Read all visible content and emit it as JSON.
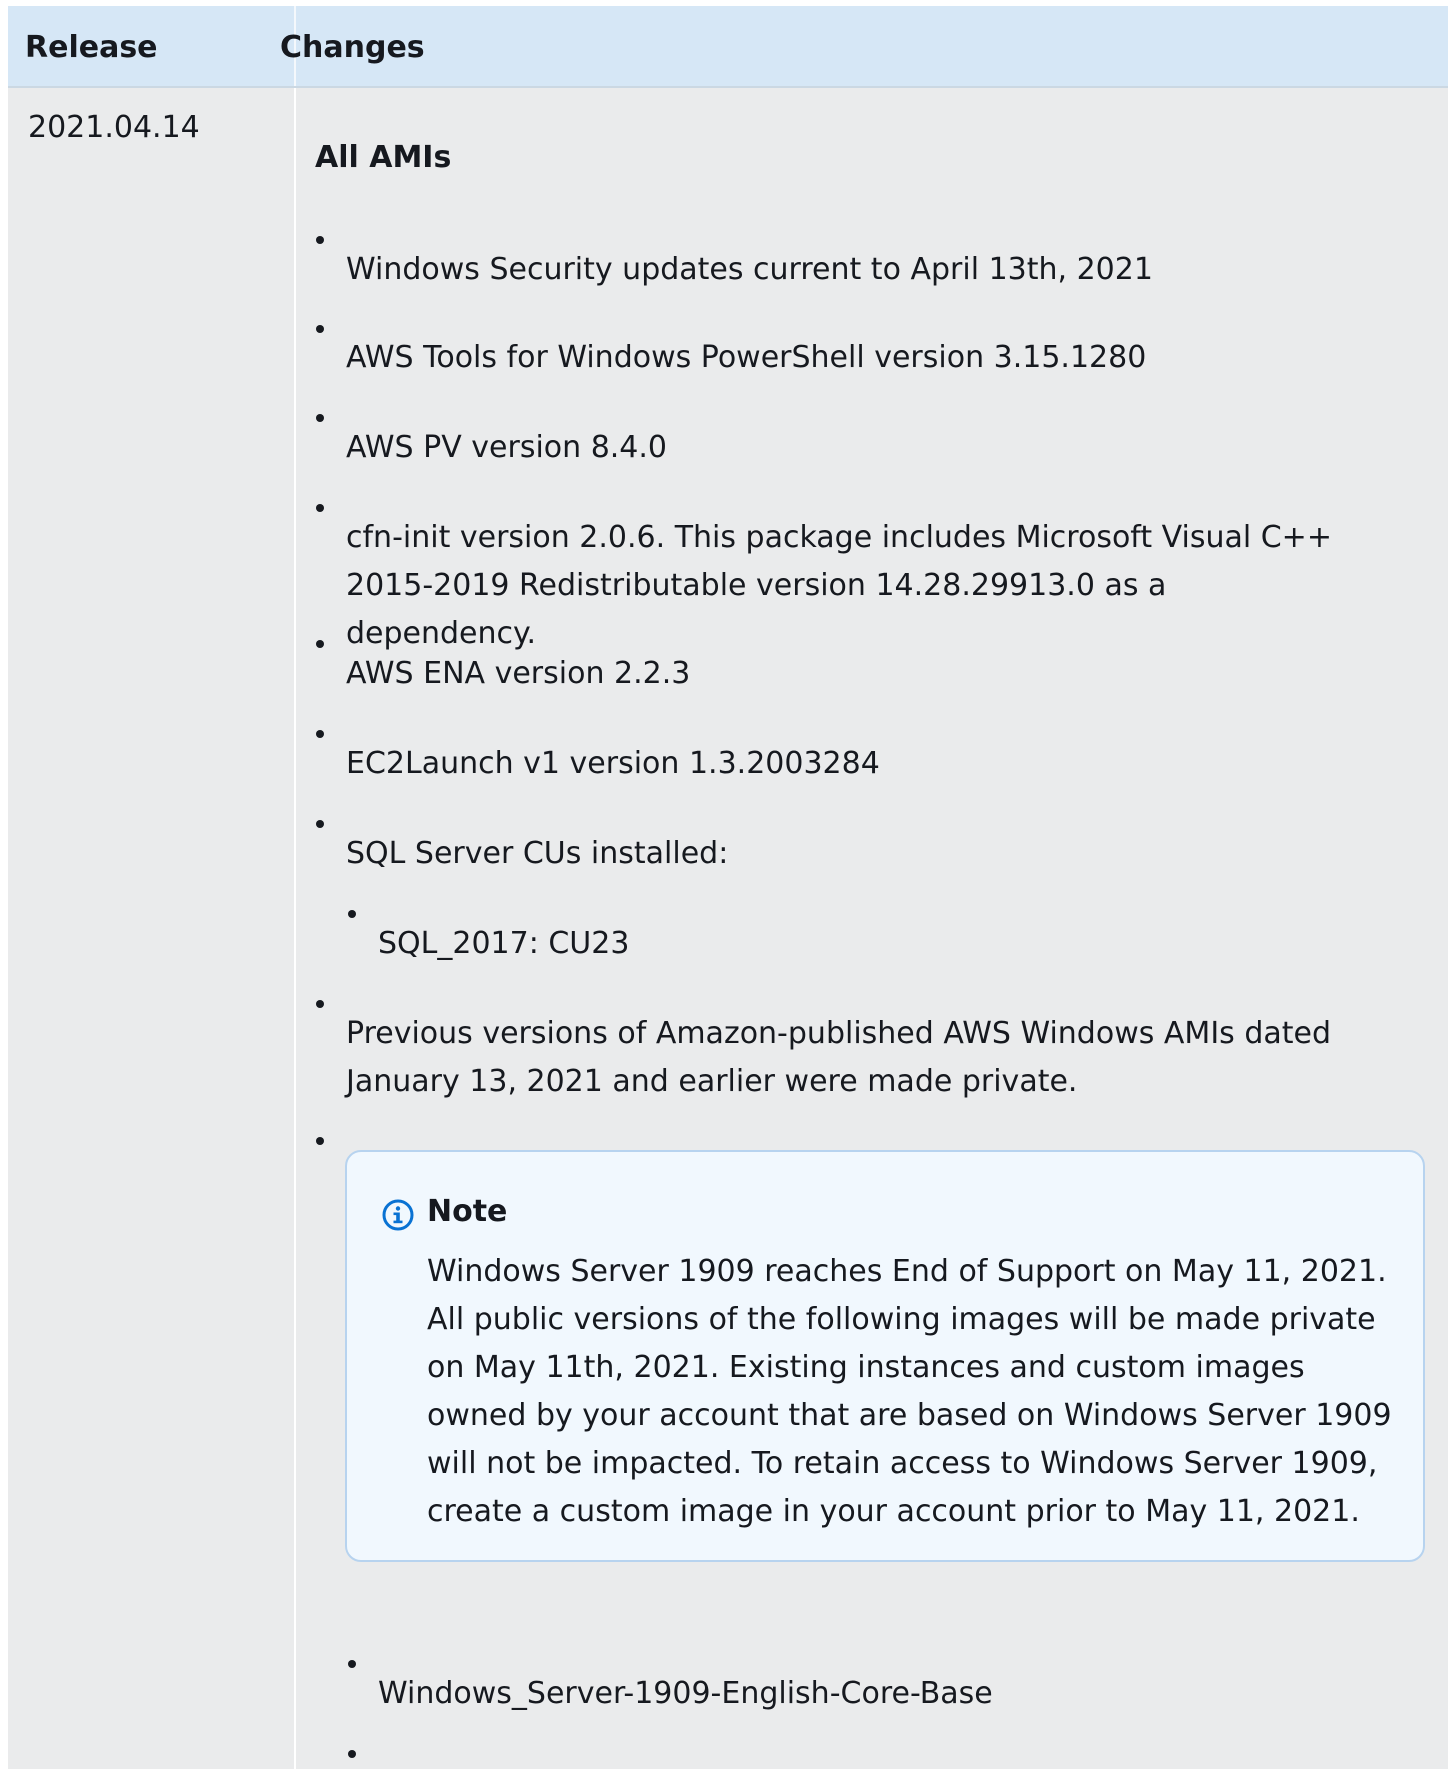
{
  "table": {
    "headers": {
      "release": "Release",
      "changes": "Changes"
    },
    "rows": [
      {
        "release": "2021.04.14",
        "section_title": "All AMIs",
        "items": [
          "Windows Security updates current to April 13th,  2021",
          "AWS Tools for Windows PowerShell version 3.15.1280",
          "AWS PV version 8.4.0",
          "cfn-init version 2.0.6. This package includes   Microsoft Visual C++ 2015-2019 Redistributable  version 14.28.29913.0 as a dependency.",
          "AWS ENA version 2.2.3",
          "EC2Launch v1 version 1.3.2003284",
          "SQL Server CUs installed:",
          "SQL_2017: CU23",
          "Previous versions of Amazon-published AWS Windows AMIs  dated January 13, 2021 and earlier were made  private."
        ],
        "note": {
          "title": "Note",
          "icon": "info-icon",
          "body": "Windows Server 1909 reaches End of Support on  May 11, 2021. All public versions of the  following images will be made private on May 11th,  2021. Existing instances and custom images owned  by your account that are based on Windows Server  1909 will not be impacted. To retain access to  Windows Server 1909, create a custom image in your  account prior to May 11, 2021."
        },
        "images": [
          "Windows_Server-1909-English-Core-Base",
          ""
        ]
      }
    ]
  },
  "colors": {
    "header_bg": "#d6e7f6",
    "body_bg": "#eaebec",
    "note_bg": "#f1f8fe",
    "note_border": "#b7d3ef",
    "info_icon": "#0972d3"
  }
}
